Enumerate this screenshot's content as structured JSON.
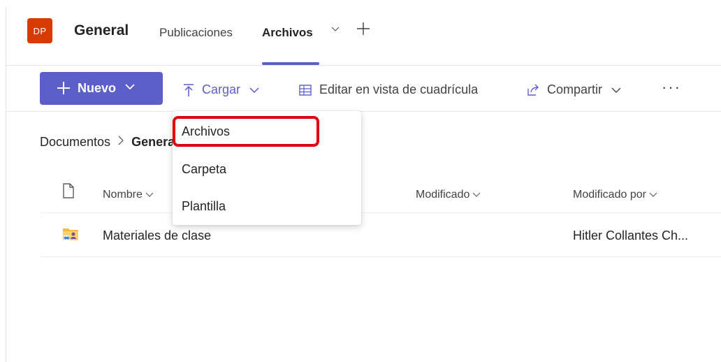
{
  "header": {
    "avatar_initials": "DP",
    "channel_title": "General",
    "tabs": [
      {
        "label": "Publicaciones"
      },
      {
        "label": "Archivos"
      }
    ],
    "add_tab_icon": "plus-icon",
    "accent_color": "#5b5fc7",
    "avatar_color": "#d73b02"
  },
  "toolbar": {
    "new_label": "Nuevo",
    "upload_label": "Cargar",
    "grid_label": "Editar en vista de cuadrícula",
    "share_label": "Compartir",
    "more_label": "···"
  },
  "breadcrumb": {
    "root": "Documentos",
    "current": "General"
  },
  "columns": {
    "name": "Nombre",
    "modified": "Modificado",
    "modified_by": "Modificado por"
  },
  "rows": [
    {
      "name": "Materiales de clase",
      "modified": "",
      "modified_by": "Hitler Collantes Ch..."
    }
  ],
  "upload_menu": {
    "items": [
      {
        "label": "Archivos"
      },
      {
        "label": "Carpeta"
      },
      {
        "label": "Plantilla"
      }
    ],
    "highlight_color": "#e2000f"
  }
}
